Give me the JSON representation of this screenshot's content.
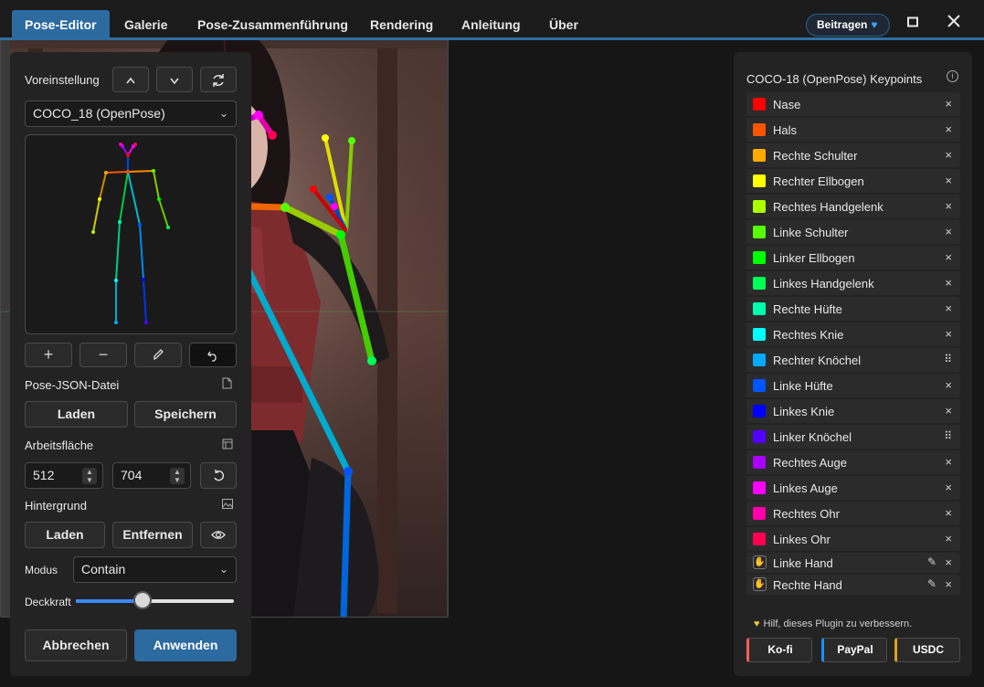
{
  "tabs": [
    {
      "label": "Pose-Editor",
      "active": true
    },
    {
      "label": "Galerie"
    },
    {
      "label": "Pose-Zusammenführung"
    },
    {
      "label": "Rendering"
    },
    {
      "label": "Anleitung"
    },
    {
      "label": "Über"
    }
  ],
  "header": {
    "donate_label": "Beitragen",
    "donate_icon": "heart-icon",
    "maximize_icon": "maximize-icon",
    "close_icon": "close-icon"
  },
  "left": {
    "preset_label": "Voreinstellung",
    "preset_value": "COCO_18 (OpenPose)",
    "json_label": "Pose-JSON-Datei",
    "load_label": "Laden",
    "save_label": "Speichern",
    "canvas_label": "Arbeitsfläche",
    "width_value": "512",
    "height_value": "704",
    "background_label": "Hintergrund",
    "bg_load_label": "Laden",
    "bg_remove_label": "Entfernen",
    "mode_label": "Modus",
    "mode_value": "Contain",
    "opacity_label": "Deckkraft",
    "opacity_value": 0.42,
    "cancel_label": "Abbrechen",
    "apply_label": "Anwenden"
  },
  "right": {
    "title": "COCO-18 (OpenPose) Keypoints",
    "keypoints": [
      {
        "name": "Nase",
        "color": "#ff0000",
        "action": "x"
      },
      {
        "name": "Hals",
        "color": "#ff5500",
        "action": "x"
      },
      {
        "name": "Rechte Schulter",
        "color": "#ffaa00",
        "action": "x"
      },
      {
        "name": "Rechter Ellbogen",
        "color": "#ffff00",
        "action": "x"
      },
      {
        "name": "Rechtes Handgelenk",
        "color": "#aaff00",
        "action": "x"
      },
      {
        "name": "Linke Schulter",
        "color": "#55ff00",
        "action": "x"
      },
      {
        "name": "Linker Ellbogen",
        "color": "#00ff00",
        "action": "x"
      },
      {
        "name": "Linkes Handgelenk",
        "color": "#00ff55",
        "action": "x"
      },
      {
        "name": "Rechte Hüfte",
        "color": "#00ffaa",
        "action": "x"
      },
      {
        "name": "Rechtes Knie",
        "color": "#00ffff",
        "action": "x"
      },
      {
        "name": "Rechter Knöchel",
        "color": "#00aaff",
        "action": "grip"
      },
      {
        "name": "Linke Hüfte",
        "color": "#0055ff",
        "action": "x"
      },
      {
        "name": "Linkes Knie",
        "color": "#0000ff",
        "action": "x"
      },
      {
        "name": "Linker Knöchel",
        "color": "#5500ff",
        "action": "grip"
      },
      {
        "name": "Rechtes Auge",
        "color": "#aa00ff",
        "action": "x"
      },
      {
        "name": "Linkes Auge",
        "color": "#ff00ff",
        "action": "x"
      },
      {
        "name": "Rechtes Ohr",
        "color": "#ff00aa",
        "action": "x"
      },
      {
        "name": "Linkes Ohr",
        "color": "#ff0055",
        "action": "x"
      }
    ],
    "hands": [
      {
        "name": "Linke Hand"
      },
      {
        "name": "Rechte Hand"
      }
    ],
    "help_text": "Hilf, dieses Plugin zu verbessern.",
    "donations": [
      {
        "label": "Ko-fi",
        "accent": "#ff5e5b"
      },
      {
        "label": "PayPal",
        "accent": "#1f8fff"
      },
      {
        "label": "USDC",
        "accent": "#e0a020"
      }
    ]
  }
}
